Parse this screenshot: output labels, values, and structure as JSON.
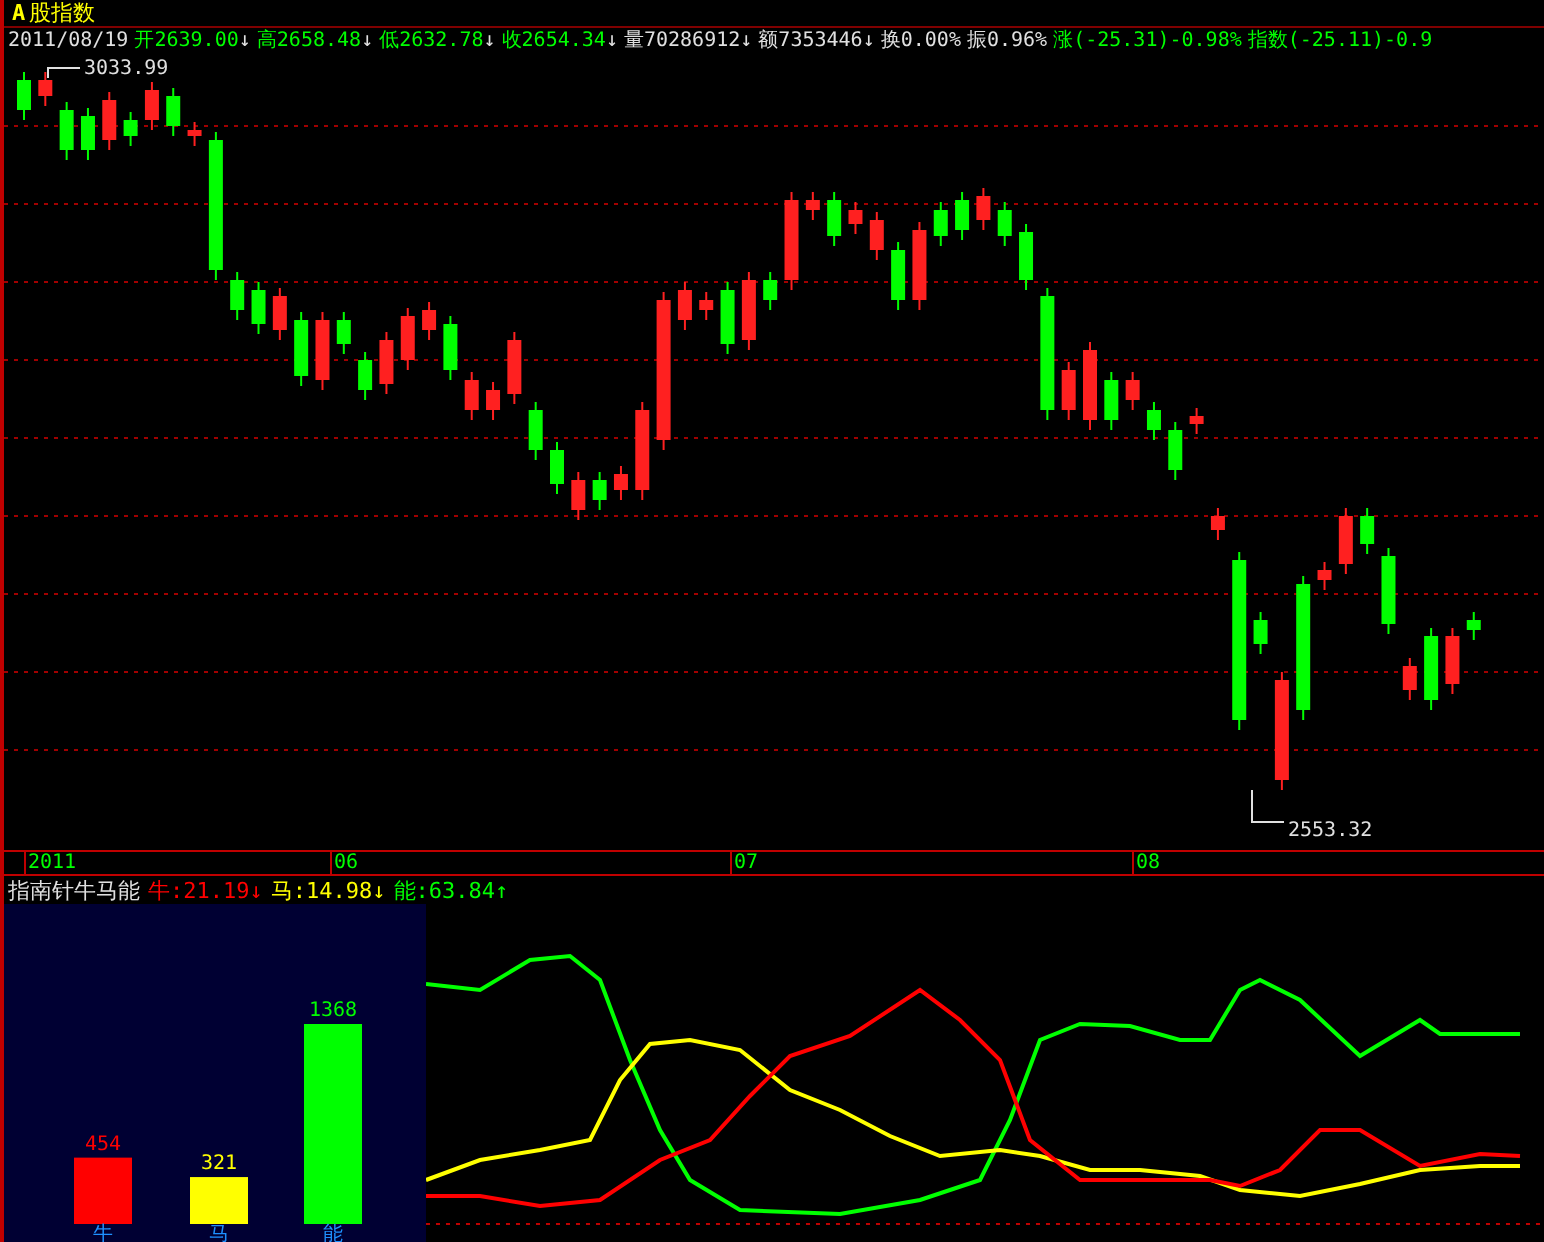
{
  "title": {
    "badge": "A",
    "text": "股指数"
  },
  "quote_bar": [
    {
      "text": "2011/08/19",
      "color": "#e0e0e0"
    },
    {
      "text": "开2639.00",
      "arrow": "↓",
      "color": "#00ff00"
    },
    {
      "text": "高2658.48",
      "arrow": "↓",
      "color": "#00ff00"
    },
    {
      "text": "低2632.78",
      "arrow": "↓",
      "color": "#00ff00"
    },
    {
      "text": "收2654.34",
      "arrow": "↓",
      "color": "#00ff00"
    },
    {
      "text": "量70286912",
      "arrow": "↓",
      "color": "#e0e0e0"
    },
    {
      "text": "额7353446",
      "arrow": "↓",
      "color": "#e0e0e0"
    },
    {
      "text": "换0.00%",
      "color": "#e0e0e0"
    },
    {
      "text": "振0.96%",
      "color": "#e0e0e0"
    },
    {
      "text": "涨(-25.31)-0.98%",
      "color": "#00ff00"
    },
    {
      "text": "指数(-25.11)-0.9",
      "color": "#00ff00"
    }
  ],
  "price_chart": {
    "high_label": "3033.99",
    "low_label": "2553.32"
  },
  "time_axis": [
    "2011",
    "06",
    "07",
    "08"
  ],
  "indicator": {
    "name": "指南针牛马能",
    "readings": [
      {
        "label": "牛:21.19",
        "arrow": "↓",
        "color": "#ff0000"
      },
      {
        "label": "马:14.98",
        "arrow": "↓",
        "color": "#ffff00"
      },
      {
        "label": "能:63.84",
        "arrow": "↑",
        "color": "#00ff00"
      }
    ]
  },
  "bar_panel": {
    "chart_data": {
      "type": "bar",
      "categories": [
        "牛",
        "马",
        "能"
      ],
      "values": [
        454,
        321,
        1368
      ],
      "data_labels": true
    }
  }
}
